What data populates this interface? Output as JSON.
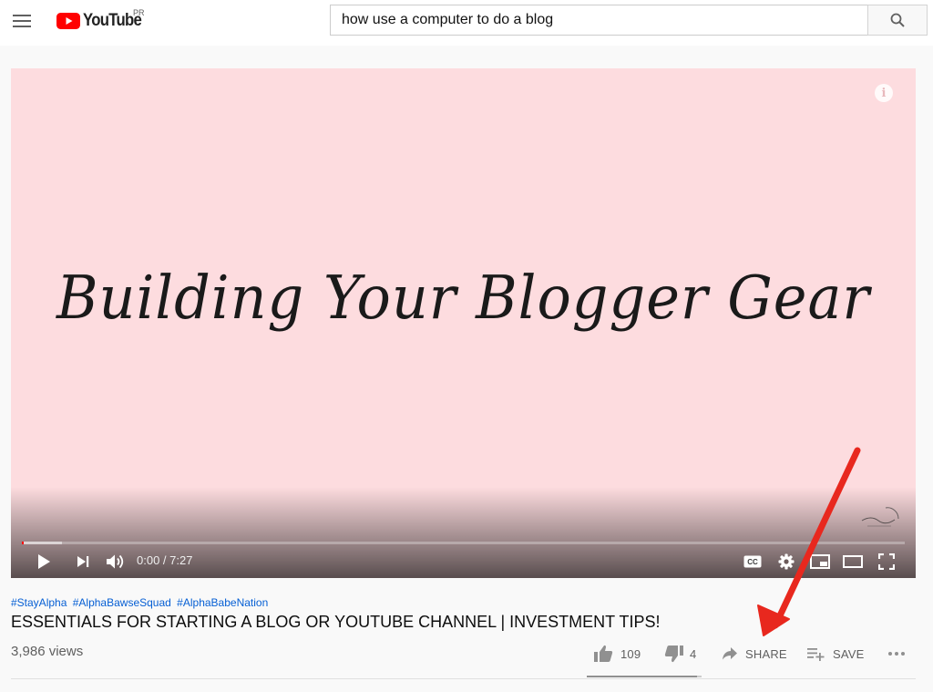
{
  "header": {
    "logo_text": "YouTube",
    "country_code": "PR",
    "search": {
      "value": "how use a computer to do a blog",
      "placeholder": "Search"
    }
  },
  "player": {
    "video_art_text": "Building Your Blogger Gear",
    "current_time": "0:00",
    "duration": "7:27",
    "time_display": "0:00 / 7:27",
    "progress_played_fraction": 0.0,
    "progress_buffered_fraction": 0.045,
    "background_color": "#fddcdf",
    "controls": [
      "play-icon",
      "next-icon",
      "volume-icon",
      "cc-icon",
      "gear-icon",
      "miniplayer-icon",
      "theater-icon",
      "fullscreen-icon"
    ]
  },
  "video": {
    "hashtags": [
      "#StayAlpha",
      "#AlphaBawseSquad",
      "#AlphaBabeNation"
    ],
    "title": "ESSENTIALS FOR STARTING A BLOG OR YOUTUBE CHANNEL | INVESTMENT TIPS!",
    "views": "3,986 views",
    "likes": "109",
    "dislikes": "4",
    "share_label": "SHARE",
    "save_label": "SAVE",
    "like_fraction": 0.96
  },
  "annotation": {
    "arrow_color": "#e8281e"
  },
  "colors": {
    "brand_red": "#ff0000",
    "link_blue": "#065fd4",
    "text_secondary": "#606060"
  }
}
